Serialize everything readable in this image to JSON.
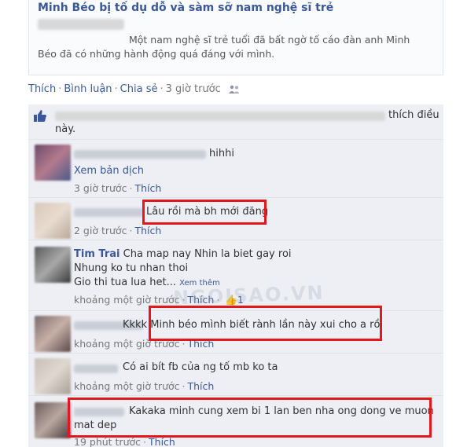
{
  "shared_post": {
    "title": "Minh Béo bị tố dụ dỗ và sàm sỡ nam nghệ sĩ trẻ",
    "description_line1": "Một nam nghệ sĩ trẻ tuổi đã bất ngờ tố cáo đàn anh Minh",
    "description_line2": "Béo đã có những hành động quá đáng với mình."
  },
  "actions": {
    "like": "Thích",
    "comment": "Bình luận",
    "share": "Chia sẻ",
    "time": "3 giờ trước",
    "audience_icon": "people-icon"
  },
  "likes": {
    "text_end": "thích điều",
    "text_line2": "này.",
    "icon": "thumbs-up-icon"
  },
  "comments": [
    {
      "text": "hihhi",
      "extra": "Xem bản dịch",
      "time": "3 giờ trước",
      "like": "Thích"
    },
    {
      "text": "Lâu rồi mà bh mới đăng",
      "time": "2 giờ trước",
      "like": "Thích"
    },
    {
      "name": "Tim Trai",
      "line1": "Cha map nay Nhin la biet gay roi",
      "line2": "Nhung ko tu nhan thoi",
      "line3": "Gio thi tua lua het...",
      "see_more": "Xem thêm",
      "time": "khoảng một giờ trước",
      "like": "Thích",
      "like_count": "1"
    },
    {
      "text": "Kkkk Minh béo mình biết rành lần này xui cho a rồi",
      "time": "khoảng một giờ trước",
      "like": "Thích"
    },
    {
      "text": "Có ai bít fb của ng tố mb ko ta",
      "time": "khoảng một giờ trước",
      "like": "Thích"
    },
    {
      "line1": "Kakaka minh cung xem bi 1 lan ben nha ong dong ve muon",
      "line2": "mat dep",
      "time": "19 phút trước",
      "like": "Thích"
    }
  ],
  "watermark": "NGOISAO.VN",
  "colors": {
    "link": "#3b5998",
    "highlight": "#e0191b",
    "panel": "#edeff4"
  }
}
